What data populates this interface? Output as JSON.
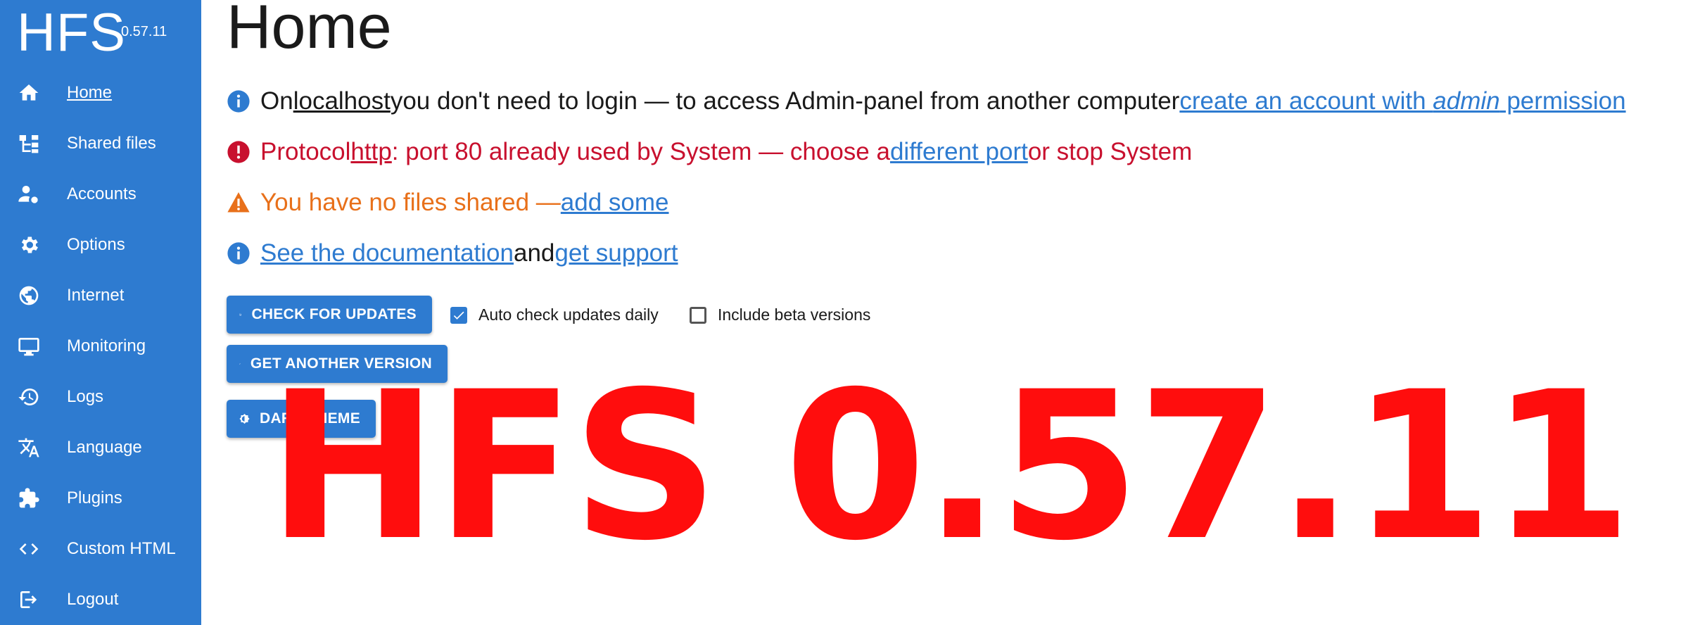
{
  "brand": {
    "name": "HFS",
    "version": "0.57.11"
  },
  "sidebar": {
    "items": [
      {
        "label": "Home",
        "icon": "home-icon"
      },
      {
        "label": "Shared files",
        "icon": "tree-icon"
      },
      {
        "label": "Accounts",
        "icon": "user-gear-icon"
      },
      {
        "label": "Options",
        "icon": "gear-icon"
      },
      {
        "label": "Internet",
        "icon": "globe-icon"
      },
      {
        "label": "Monitoring",
        "icon": "monitor-icon"
      },
      {
        "label": "Logs",
        "icon": "history-icon"
      },
      {
        "label": "Language",
        "icon": "translate-icon"
      },
      {
        "label": "Plugins",
        "icon": "puzzle-icon"
      },
      {
        "label": "Custom HTML",
        "icon": "code-icon"
      },
      {
        "label": "Logout",
        "icon": "logout-icon"
      }
    ]
  },
  "page": {
    "title": "Home"
  },
  "messages": {
    "localhost": {
      "t1": "On ",
      "host": "localhost",
      "t2": " you don't need to login — to access Admin-panel from another computer ",
      "link1": "create an account with ",
      "link_em": "admin",
      "link2": " permission"
    },
    "port": {
      "t1": "Protocol ",
      "proto": "http",
      "t2": ": port 80 already used by System — choose a ",
      "link": "different port",
      "t3": " or stop System"
    },
    "files": {
      "t1": "You have no files shared — ",
      "link": "add some"
    },
    "docs": {
      "link1": "See the documentation",
      "t1": " and ",
      "link2": "get support"
    }
  },
  "buttons": {
    "check_updates": "CHECK FOR UPDATES",
    "another_version": "GET ANOTHER VERSION",
    "dark_theme": "DARK THEME"
  },
  "checkboxes": {
    "auto_check": {
      "label": "Auto check updates daily",
      "checked": true
    },
    "beta": {
      "label": "Include beta versions",
      "checked": false
    }
  },
  "banner": "HFS 0.57.11",
  "colors": {
    "accent": "#2e7bd0",
    "error": "#c8102e",
    "warning": "#e8701a",
    "banner": "#ff0d0d"
  }
}
